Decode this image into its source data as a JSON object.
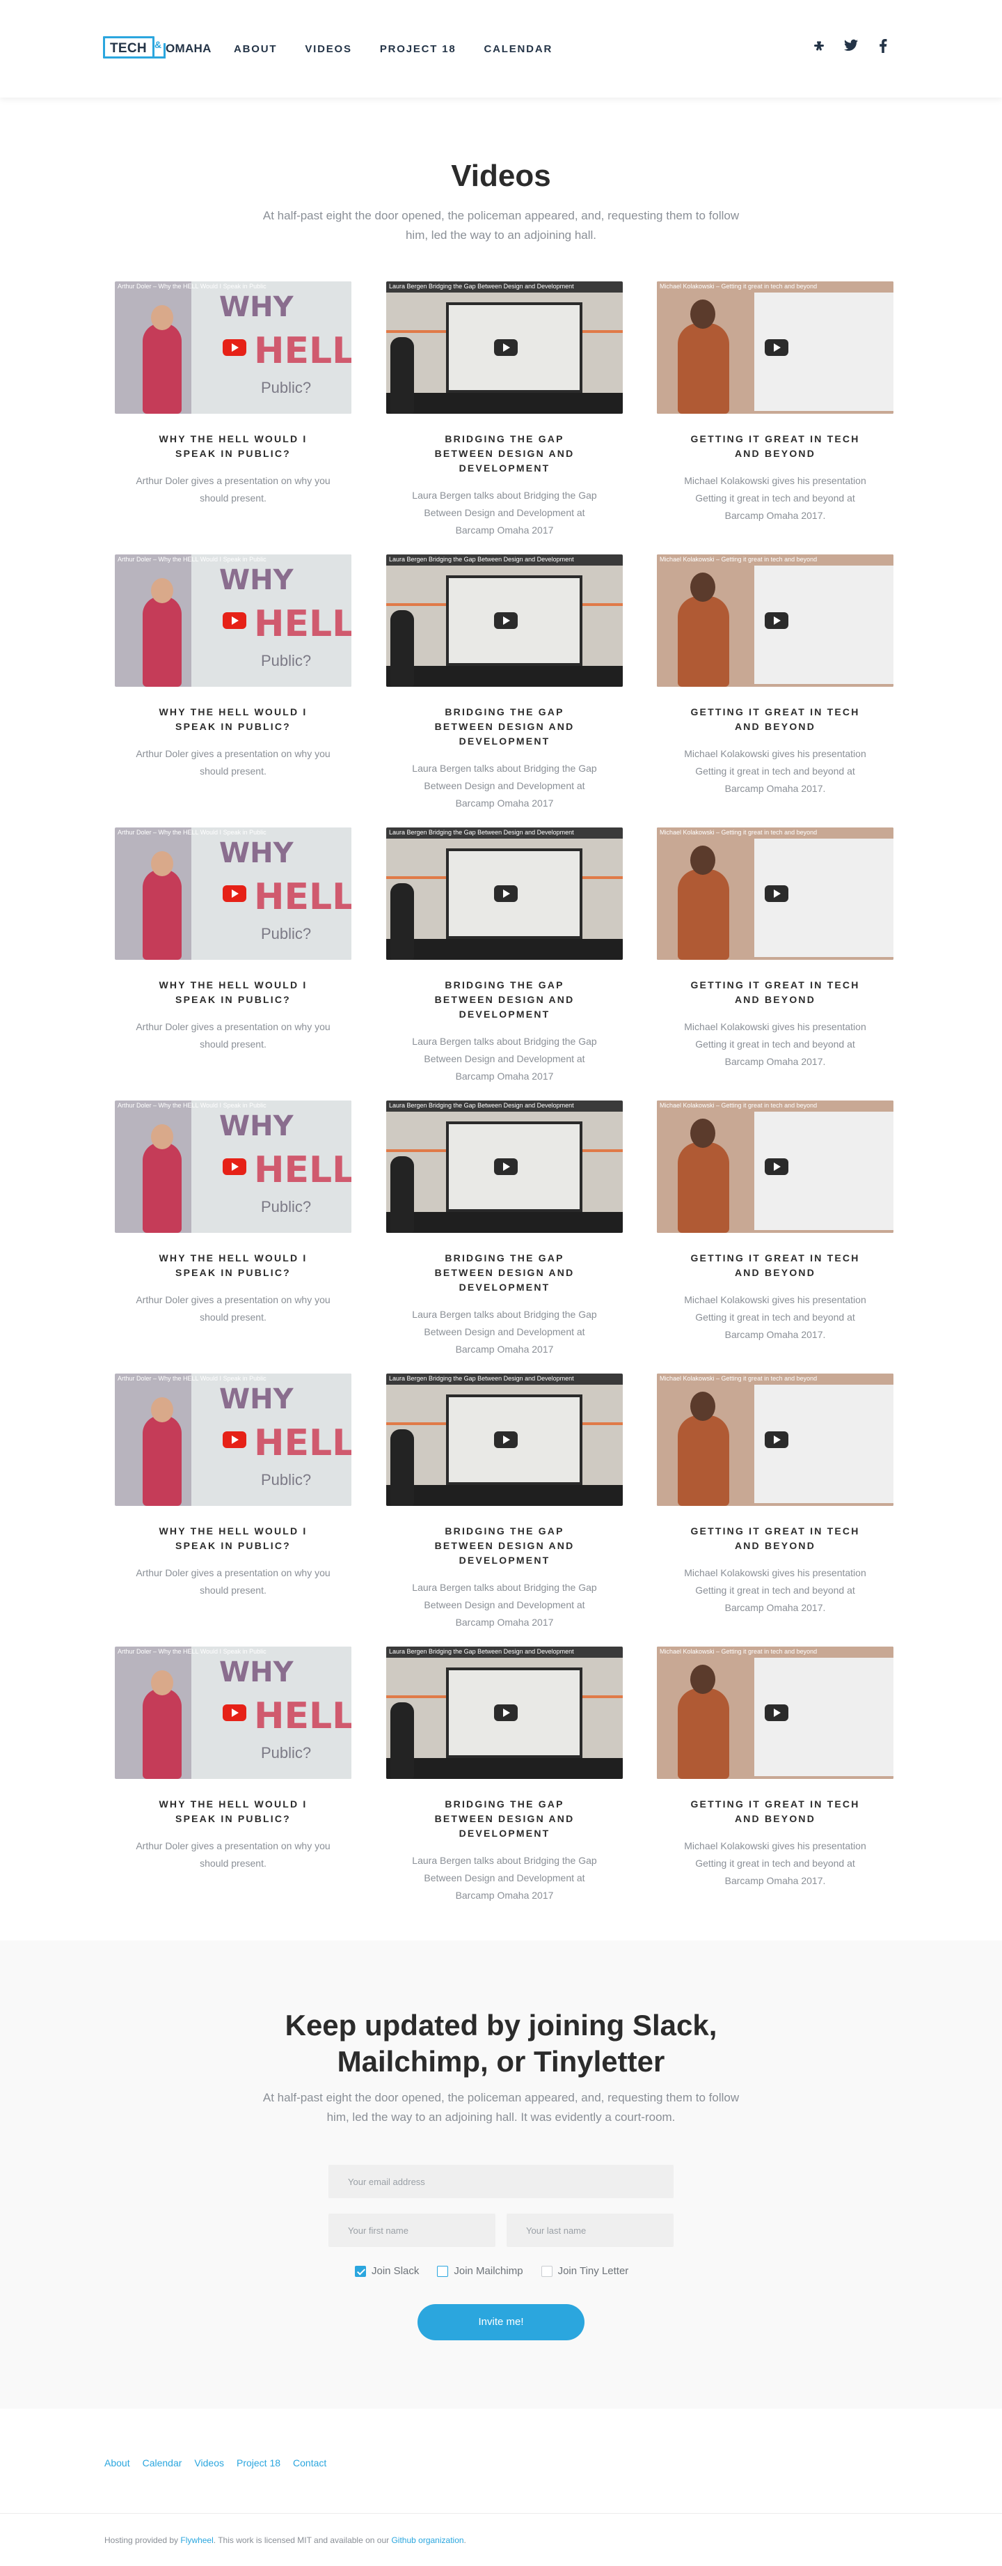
{
  "header": {
    "logo_left": "TECH",
    "logo_amp": "&",
    "logo_right": "OMAHA",
    "nav": [
      "About",
      "Videos",
      "Project 18",
      "Calendar"
    ],
    "social": [
      "slack-icon",
      "twitter-icon",
      "facebook-icon"
    ]
  },
  "videos": {
    "title": "Videos",
    "subtitle": "At half-past eight the door opened, the policeman appeared, and, requesting them to follow him, led the way to an adjoining hall.",
    "cards": [
      {
        "thumb_title": "Arthur Doler – Why the HELL Would I Speak in Public",
        "title": "Why the hell would I speak in public?",
        "description": "Arthur Doler gives a presentation on why you should present."
      },
      {
        "thumb_title": "Laura Bergen Bridging the Gap Between Design and Development",
        "title": "Bridging the gap between design and development",
        "description": "Laura Bergen talks about Bridging the Gap Between Design and Development at Barcamp Omaha 2017"
      },
      {
        "thumb_title": "Michael Kolakowski – Getting it great in tech and beyond",
        "title": "Getting it great in tech and beyond",
        "description": "Michael Kolakowski gives his presentation Getting it great in tech and beyond at Barcamp Omaha 2017."
      }
    ]
  },
  "signup": {
    "title": "Keep updated by joining Slack, Mailchimp, or Tinyletter",
    "subtitle": "At half-past eight the door opened, the policeman appeared, and, requesting them to follow him, led the way to an adjoining hall. It was evidently a court-room.",
    "email_placeholder": "Your email address",
    "first_placeholder": "Your first name",
    "last_placeholder": "Your last name",
    "check_slack": "Join Slack",
    "check_mailchimp": "Join Mailchimp",
    "check_tinyletter": "Join Tiny Letter",
    "button": "Invite me!"
  },
  "footer": {
    "links": [
      "About",
      "Calendar",
      "Videos",
      "Project 18",
      "Contact"
    ],
    "text_1": "Hosting provided by",
    "link_1": "Flywheel",
    "text_2": ". This work is licensed MIT and available on our",
    "link_2": "Github organization",
    "text_3": "."
  }
}
